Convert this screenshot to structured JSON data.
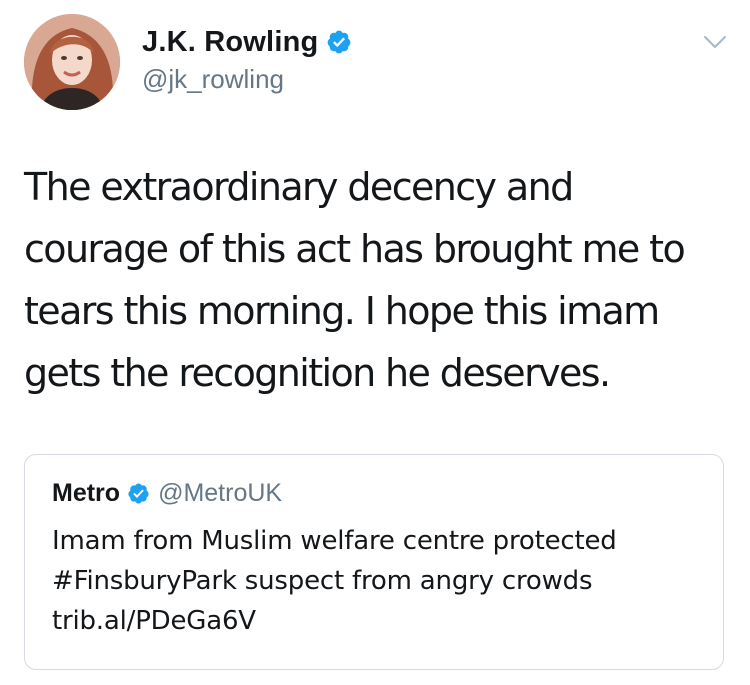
{
  "author": {
    "display_name": "J.K. Rowling",
    "handle": "@jk_rowling",
    "verified": true,
    "avatar_icon": "profile-photo"
  },
  "menu": {
    "icon": "chevron-down-icon"
  },
  "tweet": {
    "lines": [
      "The extraordinary decency and",
      "courage of this act has brought me to",
      "tears this morning. I hope this imam",
      "gets the recognition he deserves."
    ]
  },
  "quoted_tweet": {
    "display_name": "Metro",
    "handle": "@MetroUK",
    "verified": true,
    "lines": [
      "Imam from Muslim welfare centre protected",
      "#FinsburyPark suspect from angry crowds",
      "trib.al/PDeGa6V"
    ]
  },
  "colors": {
    "text": "#14171a",
    "secondary": "#657786",
    "verified_blue": "#1da1f2",
    "border": "#d5dbe0"
  }
}
